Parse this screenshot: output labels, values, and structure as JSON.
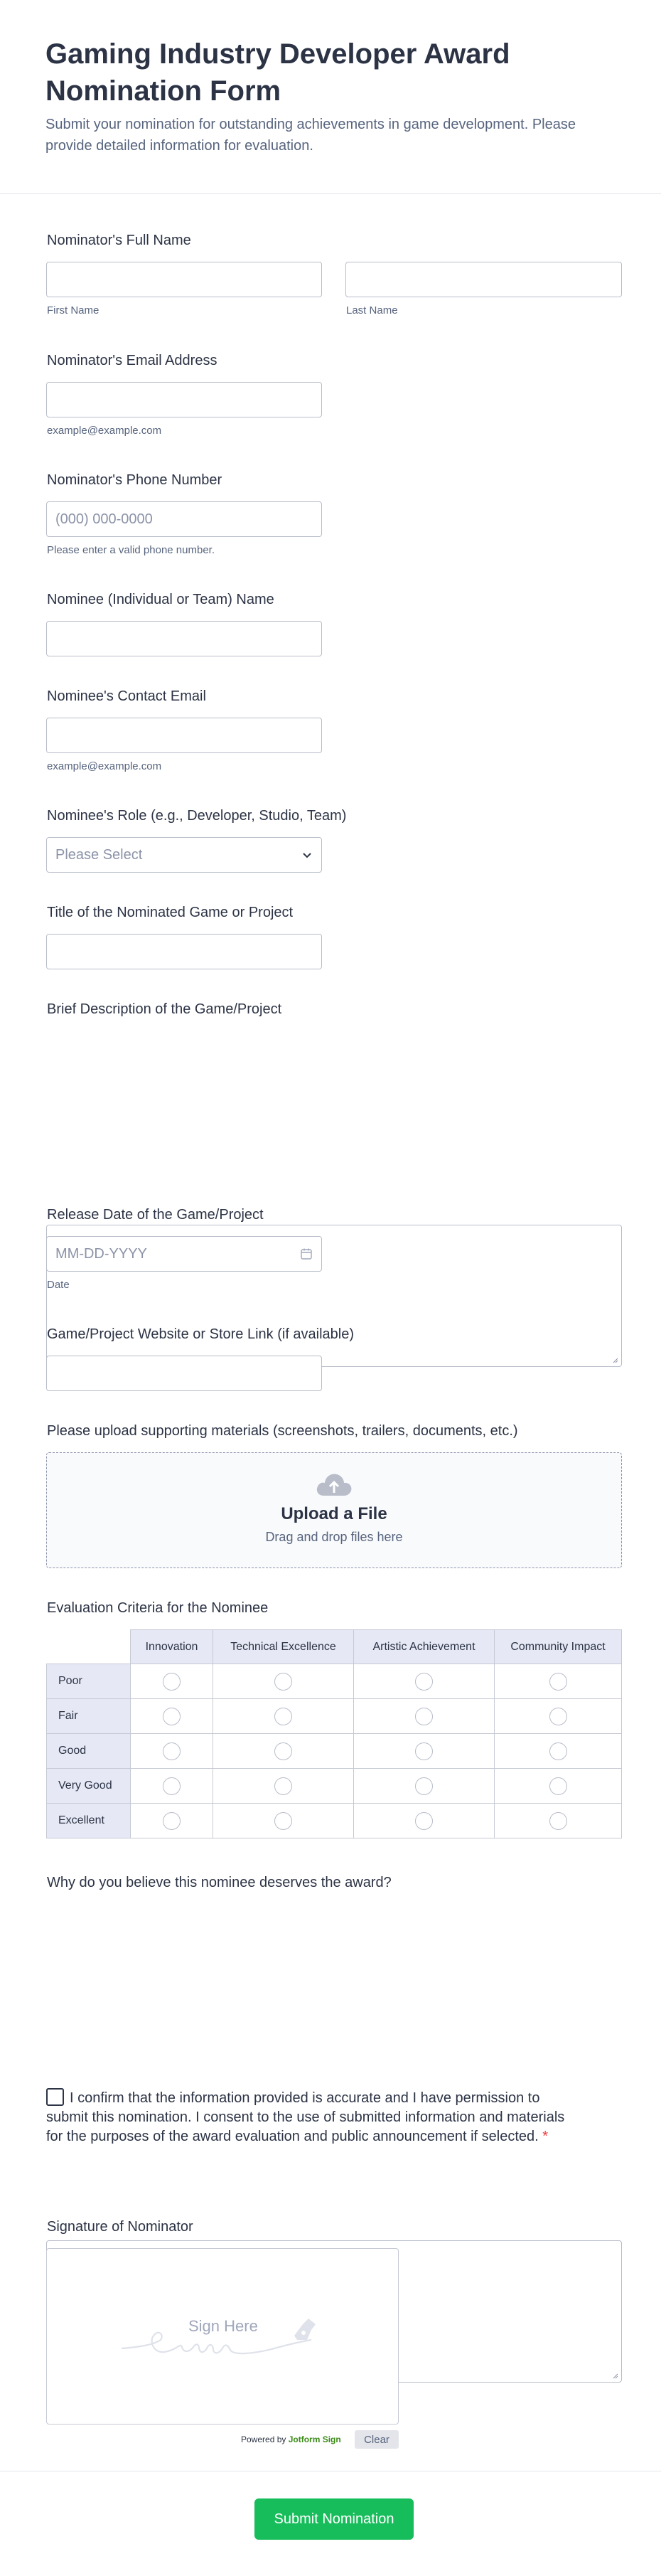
{
  "header": {
    "title": "Gaming Industry Developer Award Nomination Form",
    "subtitle": "Submit your nomination for outstanding achievements in game development. Please provide detailed information for evaluation."
  },
  "fields": {
    "nominator_name": {
      "label": "Nominator's Full Name",
      "first_sub": "First Name",
      "last_sub": "Last Name"
    },
    "nominator_email": {
      "label": "Nominator's Email Address",
      "sub": "example@example.com"
    },
    "nominator_phone": {
      "label": "Nominator's Phone Number",
      "placeholder": "(000) 000-0000",
      "sub": "Please enter a valid phone number."
    },
    "nominee_name": {
      "label": "Nominee (Individual or Team) Name"
    },
    "nominee_email": {
      "label": "Nominee's Contact Email",
      "sub": "example@example.com"
    },
    "nominee_role": {
      "label": "Nominee's Role (e.g., Developer, Studio, Team)",
      "placeholder": "Please Select"
    },
    "project_title": {
      "label": "Title of the Nominated Game or Project"
    },
    "description": {
      "label": "Brief Description of the Game/Project"
    },
    "release_date": {
      "label": "Release Date of the Game/Project",
      "placeholder": "MM-DD-YYYY",
      "sub": "Date"
    },
    "website": {
      "label": "Game/Project Website or Store Link (if available)"
    },
    "upload": {
      "label": "Please upload supporting materials (screenshots, trailers, documents, etc.)",
      "title": "Upload a File",
      "sub": "Drag and drop files here"
    },
    "criteria": {
      "label": "Evaluation Criteria for the Nominee",
      "columns": [
        "Innovation",
        "Technical Excellence",
        "Artistic Achievement",
        "Community Impact"
      ],
      "rows": [
        "Poor",
        "Fair",
        "Good",
        "Very Good",
        "Excellent"
      ]
    },
    "why": {
      "label": "Why do you believe this nominee deserves the award?"
    },
    "consent": {
      "text": "I confirm that the information provided is accurate and I have permission to submit this nomination. I consent to the use of submitted information and materials for the purposes of the award evaluation and public announcement if selected.",
      "required_mark": "*"
    },
    "signature": {
      "label": "Signature of Nominator",
      "hint": "Sign Here",
      "powered_prefix": "Powered by",
      "powered_brand": "Jotform Sign",
      "clear_label": "Clear"
    }
  },
  "submit": {
    "label": "Submit Nomination"
  },
  "colors": {
    "submit": "#18bd5b",
    "matrix_header": "#e6e9f5",
    "required": "#f23a3c"
  }
}
